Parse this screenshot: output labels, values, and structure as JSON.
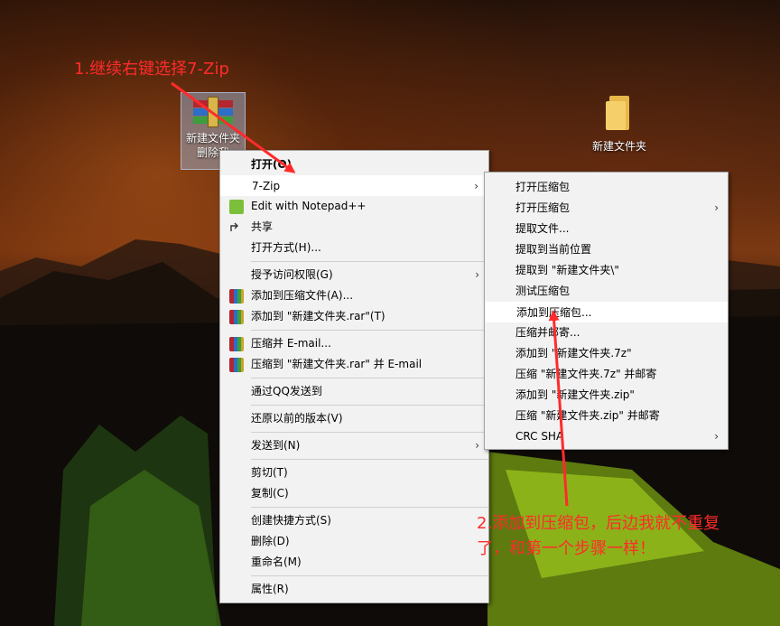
{
  "desktop": {
    "icons": [
      {
        "label_line1": "新建文件夹",
        "label_line2": "删除我"
      },
      {
        "label": "新建文件夹"
      }
    ]
  },
  "context_menu": {
    "items": [
      {
        "label": "打开(O)",
        "bold": true
      },
      {
        "label": "7-Zip",
        "arrow": "›"
      },
      {
        "label": "Edit with Notepad++"
      },
      {
        "label": "共享"
      },
      {
        "label": "打开方式(H)..."
      },
      {
        "label": "授予访问权限(G)",
        "arrow": "›"
      },
      {
        "label": "添加到压缩文件(A)..."
      },
      {
        "label": "添加到 \"新建文件夹.rar\"(T)"
      },
      {
        "label": "压缩并 E-mail..."
      },
      {
        "label": "压缩到 \"新建文件夹.rar\" 并 E-mail"
      },
      {
        "label": "通过QQ发送到"
      },
      {
        "label": "还原以前的版本(V)"
      },
      {
        "label": "发送到(N)",
        "arrow": "›"
      },
      {
        "label": "剪切(T)"
      },
      {
        "label": "复制(C)"
      },
      {
        "label": "创建快捷方式(S)"
      },
      {
        "label": "删除(D)"
      },
      {
        "label": "重命名(M)"
      },
      {
        "label": "属性(R)"
      }
    ]
  },
  "zip_submenu": {
    "items": [
      {
        "label": "打开压缩包"
      },
      {
        "label": "打开压缩包",
        "arrow": "›"
      },
      {
        "label": "提取文件..."
      },
      {
        "label": "提取到当前位置"
      },
      {
        "label": "提取到 \"新建文件夹\\\""
      },
      {
        "label": "测试压缩包"
      },
      {
        "label": "添加到压缩包..."
      },
      {
        "label": "压缩并邮寄..."
      },
      {
        "label": "添加到 \"新建文件夹.7z\""
      },
      {
        "label": "压缩 \"新建文件夹.7z\" 并邮寄"
      },
      {
        "label": "添加到 \"新建文件夹.zip\""
      },
      {
        "label": "压缩 \"新建文件夹.zip\" 并邮寄"
      },
      {
        "label": "CRC SHA",
        "arrow": "›"
      }
    ]
  },
  "annotations": {
    "step1": "1.继续右键选择7-Zip",
    "step2_line1": "2.添加到压缩包，后边我就不重复",
    "step2_line2": "了，和第一个步骤一样！",
    "color": "#ff2b2b"
  },
  "colors": {
    "menu_bg": "#f2f2f2",
    "highlight_bg": "#ffffff",
    "annotation_red": "#ff2b2b"
  }
}
